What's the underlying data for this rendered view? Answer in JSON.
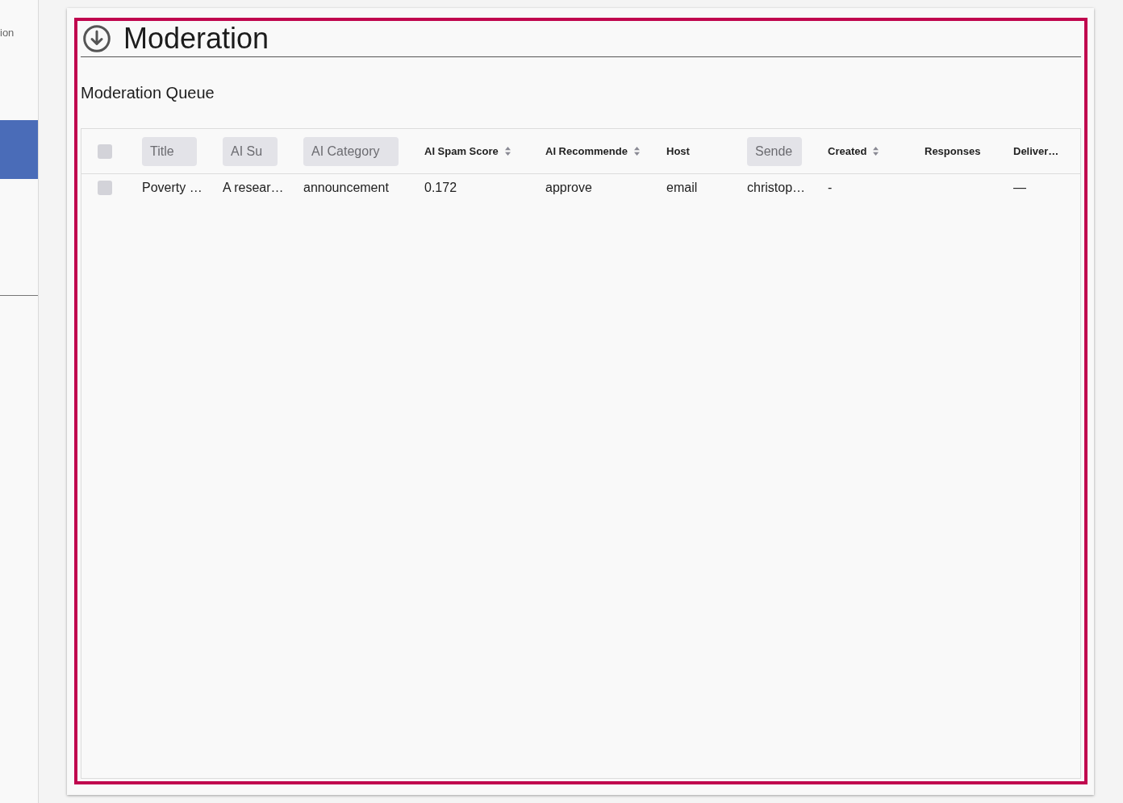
{
  "sidebar": {
    "items": [
      {
        "label": "ion",
        "selected": false
      },
      {
        "selected": true
      }
    ]
  },
  "page": {
    "title": "Moderation"
  },
  "section_title": "Moderation Queue",
  "table": {
    "select_all": {
      "checked": false
    },
    "columns": [
      {
        "label": "Title",
        "kind": "chip"
      },
      {
        "label": "AI Su",
        "kind": "chip"
      },
      {
        "label": "AI Category",
        "kind": "chip"
      },
      {
        "label": "AI Spam Score",
        "kind": "sort"
      },
      {
        "label": "AI Recommende",
        "kind": "sort"
      },
      {
        "label": "Host",
        "kind": "text"
      },
      {
        "label": "Sende",
        "kind": "chip"
      },
      {
        "label": "Created",
        "kind": "sort"
      },
      {
        "label": "Responses",
        "kind": "text"
      },
      {
        "label": "Deliver…",
        "kind": "text"
      }
    ],
    "rows": [
      {
        "checked": false,
        "cells": [
          {
            "text": "Poverty …"
          },
          {
            "text": "A resear…"
          },
          {
            "text": "announcement"
          },
          {
            "text": "0.172"
          },
          {
            "text": "approve"
          },
          {
            "text": "email"
          },
          {
            "text": "christop…"
          },
          {
            "text": "-"
          },
          {},
          {
            "text": "—"
          }
        ]
      }
    ]
  }
}
